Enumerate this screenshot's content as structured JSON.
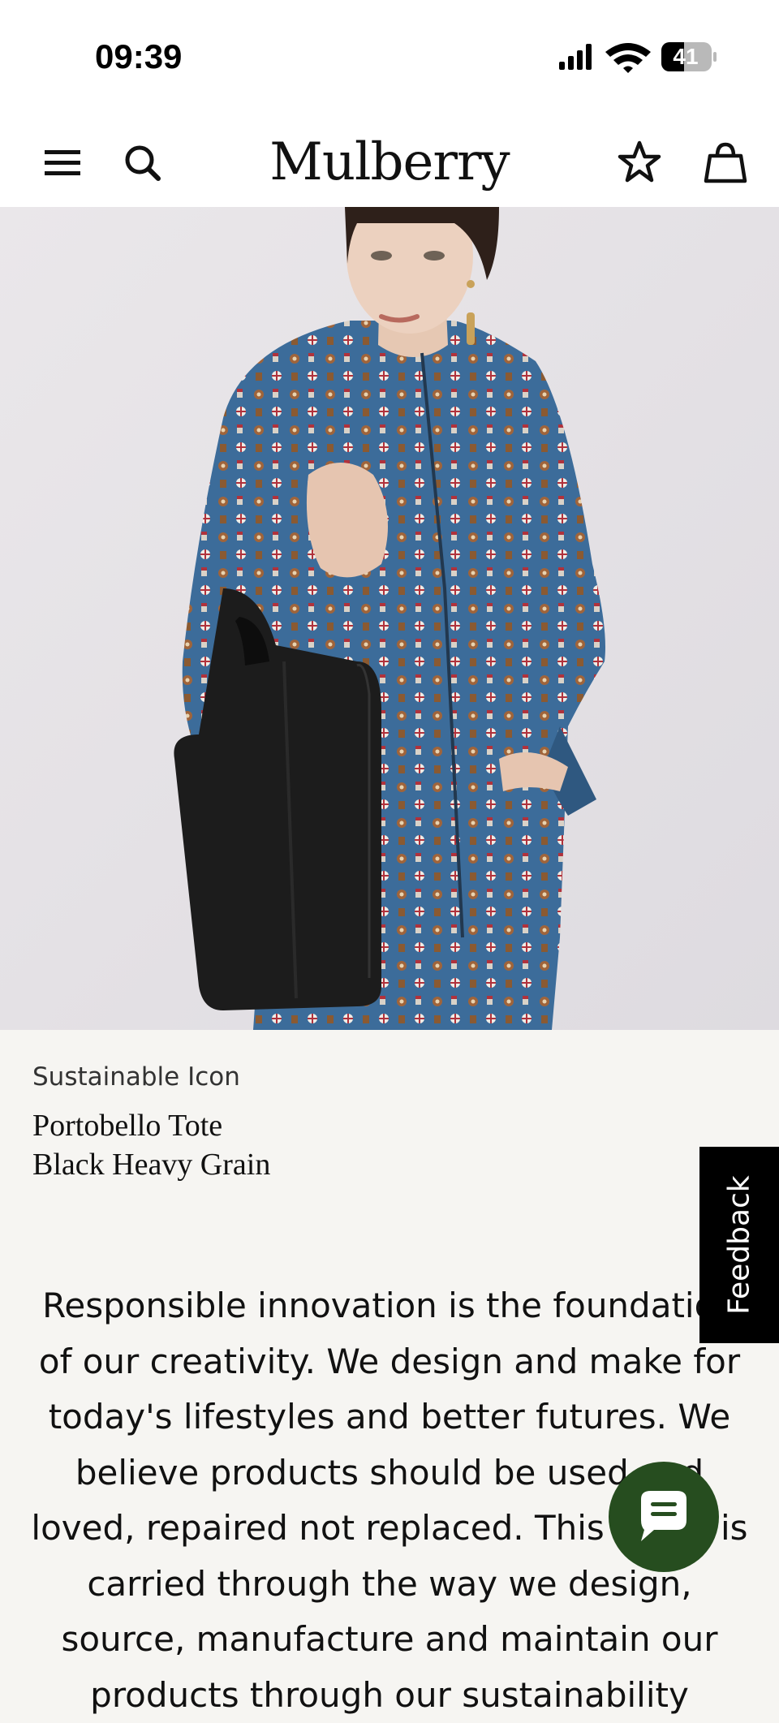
{
  "status_bar": {
    "time": "09:39",
    "battery": "41"
  },
  "header": {
    "logo": "Mulberry",
    "icons": [
      "menu-icon",
      "search-icon",
      "star-icon",
      "bag-icon"
    ]
  },
  "product": {
    "tag": "Sustainable Icon",
    "name": "Portobello Tote",
    "variant": "Black Heavy Grain"
  },
  "description": "Responsible innovation is the foundation of our creativity. We design and make for today's lifestyles and better futures. We believe products should be used and loved, repaired not replaced. This ethos is carried through the way we design, source, manufacture and maintain our products through our sustainability",
  "feedback": {
    "label": "Feedback"
  },
  "chat": {
    "icon": "chat-icon"
  },
  "colors": {
    "background": "#f6f5f2",
    "header": "#ffffff",
    "feedback_tab": "#000000",
    "chat_button": "#264d1f",
    "garment": "#3c6c9a"
  }
}
